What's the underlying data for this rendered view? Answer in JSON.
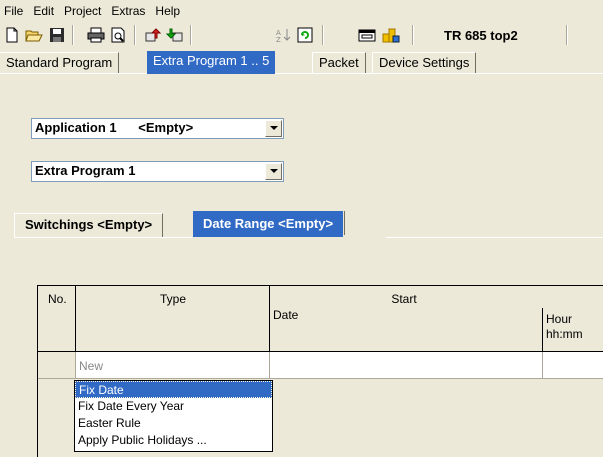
{
  "menu": [
    "File",
    "Edit",
    "Project",
    "Extras",
    "Help"
  ],
  "toolbar": {
    "icons": [
      "new-file",
      "open-folder",
      "save",
      "print",
      "print-preview",
      "upload",
      "download",
      "sort",
      "refresh",
      "window",
      "users"
    ],
    "device_label": "TR 685 top2"
  },
  "main_tabs": [
    {
      "label": "Standard Program",
      "active": false
    },
    {
      "label": "Extra Program 1 .. 5",
      "active": true
    },
    {
      "label": "Packet",
      "active": false
    },
    {
      "label": "Device Settings",
      "active": false
    }
  ],
  "application_select": {
    "value": "Application 1      <Empty>"
  },
  "program_select": {
    "value": "Extra Program 1"
  },
  "sub_tabs": [
    {
      "label": "Switchings  <Empty>",
      "active": false
    },
    {
      "label": "Date Range  <Empty>",
      "active": true
    }
  ],
  "grid": {
    "headers": {
      "no": "No.",
      "type": "Type",
      "start": "Start",
      "date": "Date",
      "hour": "Hour",
      "hour_unit": "hh:mm"
    },
    "rows": [
      {
        "no": "",
        "type": "New"
      }
    ]
  },
  "type_options": [
    "Fix Date",
    "Fix Date Every Year",
    "Easter Rule",
    "Apply Public Holidays ..."
  ],
  "type_selected": "Fix Date",
  "colors": {
    "selection": "#316ac5",
    "face": "#ece9d8"
  }
}
